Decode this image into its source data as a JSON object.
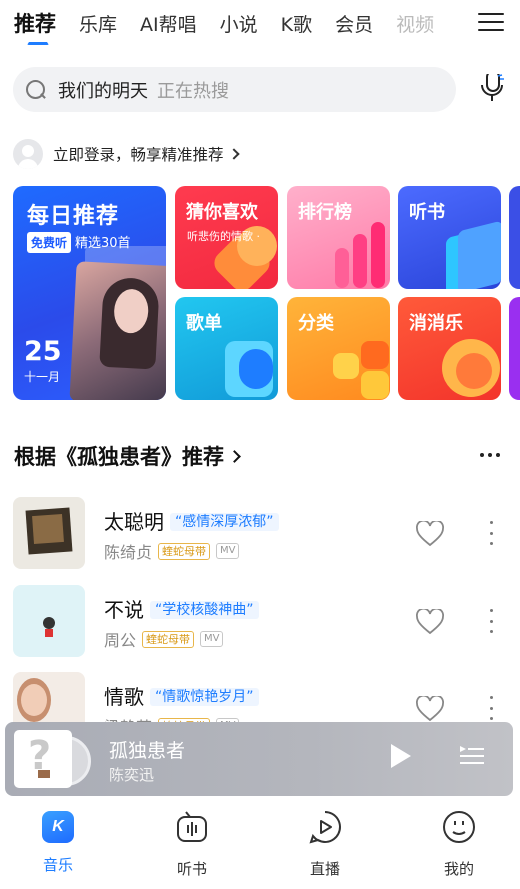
{
  "nav": {
    "tabs": [
      {
        "label": "推荐"
      },
      {
        "label": "乐库"
      },
      {
        "label": "AI帮唱"
      },
      {
        "label": "小说"
      },
      {
        "label": "K歌"
      },
      {
        "label": "会员"
      },
      {
        "label": "视频"
      }
    ],
    "active_tab": "推荐",
    "menu_icon": "hamburger-menu-icon"
  },
  "search": {
    "keyword": "我们的明天",
    "hint": "正在热搜",
    "icon": "search-icon",
    "mic_icon": "voice-recognition-icon"
  },
  "login": {
    "text": "立即登录，畅享精准推荐"
  },
  "daily": {
    "title": "每日推荐",
    "badge": "免费听",
    "subtitle": "精选30首",
    "day": "25",
    "month": "十一月"
  },
  "tiles": {
    "guess": {
      "title": "猜你喜欢",
      "subtitle": "听悲伤的情歌 ·"
    },
    "rank": {
      "title": "排行榜"
    },
    "book": {
      "title": "听书"
    },
    "playlist": {
      "title": "歌单"
    },
    "category": {
      "title": "分类"
    },
    "game": {
      "title": "消消乐"
    }
  },
  "section": {
    "title": "根据《孤独患者》推荐"
  },
  "songs": [
    {
      "name": "太聪明",
      "tag": "“感情深厚浓郁”",
      "artist": "陈绮贞",
      "vip": "蝰蛇母带",
      "mv": "MV"
    },
    {
      "name": "不说",
      "tag": "“学校核酸神曲”",
      "artist": "周公",
      "vip": "蝰蛇母带",
      "mv": "MV"
    },
    {
      "name": "情歌",
      "tag": "“情歌惊艳岁月”",
      "artist": "梁静茹",
      "vip": "蝰蛇母带",
      "mv": "MV"
    }
  ],
  "player": {
    "title": "孤独患者",
    "artist": "陈奕迅"
  },
  "tabbar": {
    "items": [
      {
        "label": "音乐",
        "icon": "music-k-icon"
      },
      {
        "label": "听书",
        "icon": "audiobook-icon"
      },
      {
        "label": "直播",
        "icon": "live-play-icon"
      },
      {
        "label": "我的",
        "icon": "profile-face-icon"
      }
    ],
    "active": "音乐"
  },
  "colors": {
    "accent": "#1e7dff",
    "daily_bg": "#2b4bea",
    "guess_bg": "#f2293f",
    "rank_bg": "#ff7ba8",
    "book_bg": "#2a44d9",
    "playlist_bg": "#119ad8",
    "category_bg": "#ff8a1f",
    "game_bg": "#f3342b"
  }
}
